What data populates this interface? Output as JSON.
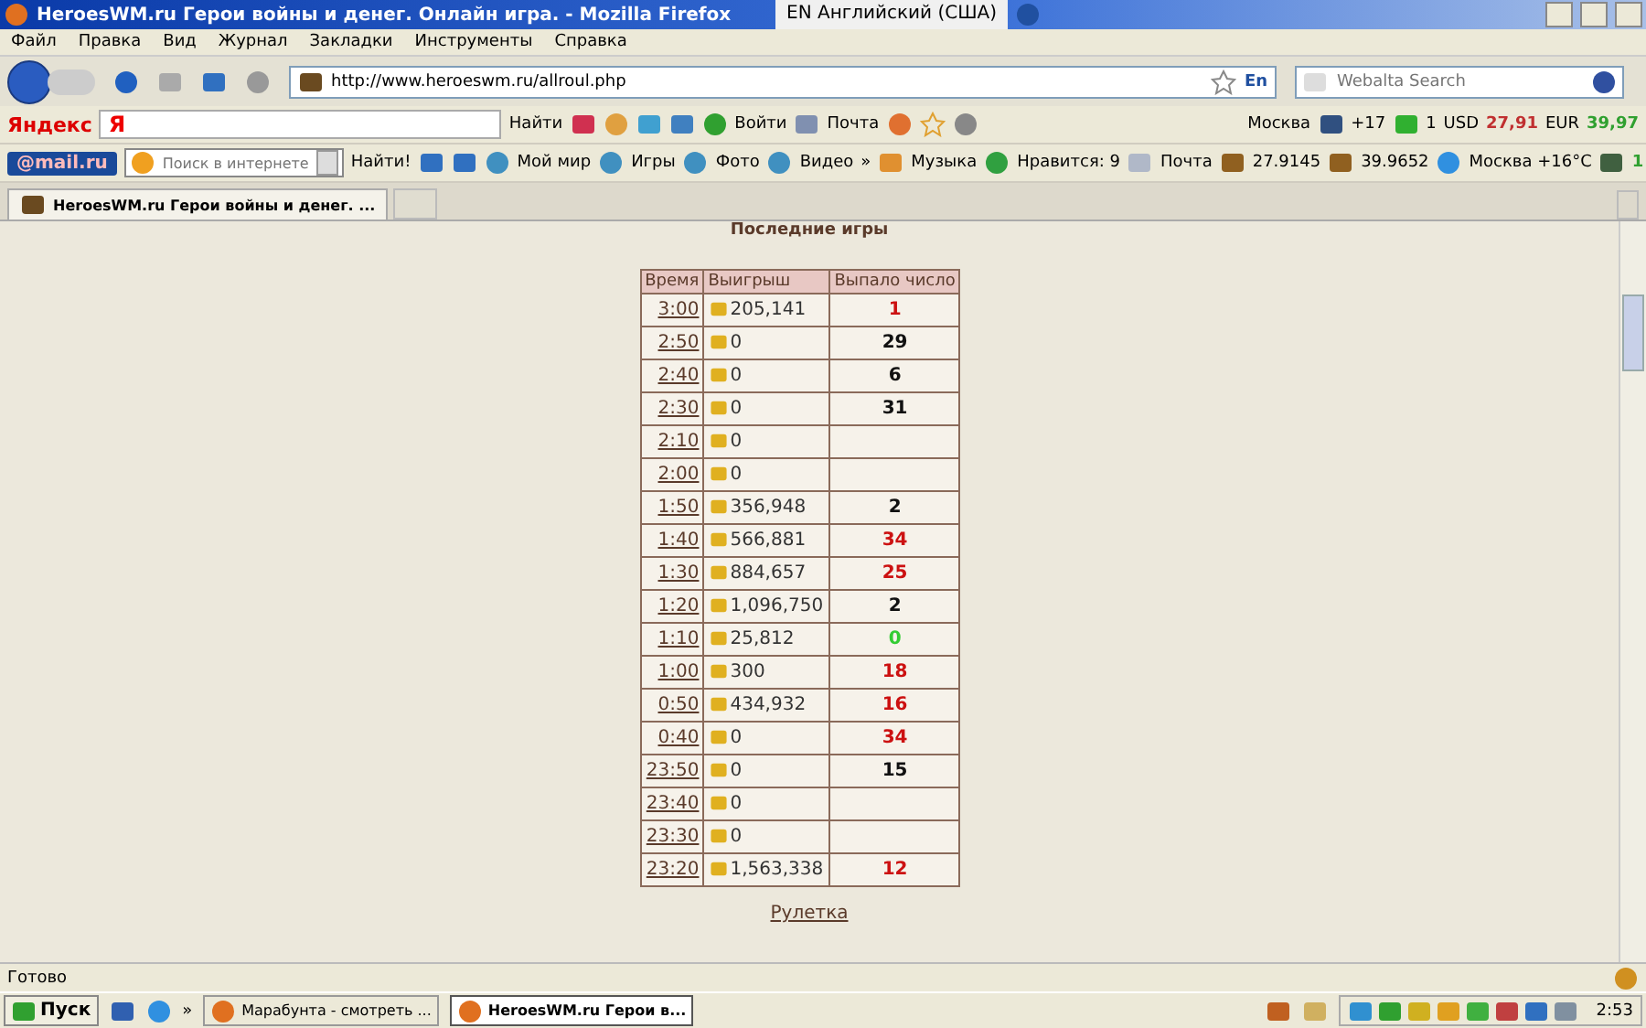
{
  "window": {
    "title": "HeroesWM.ru Герои войны и денег. Онлайн игра. - Mozilla Firefox"
  },
  "language_bar": {
    "text": "EN Английский (США)"
  },
  "menu": [
    "Файл",
    "Правка",
    "Вид",
    "Журнал",
    "Закладки",
    "Инструменты",
    "Справка"
  ],
  "nav": {
    "url": "http://www.heroeswm.ru/allroul.php",
    "lang": "En",
    "search_placeholder": "Webalta Search"
  },
  "yandex_bar": {
    "logo": "Яндекс",
    "field_logo": "Я",
    "find": "Найти",
    "login": "Войти",
    "mail": "Почта",
    "city": "Москва",
    "temp": "+17",
    "count": "1",
    "usd_label": "USD",
    "usd": "27,91",
    "eur_label": "EUR",
    "eur": "39,97"
  },
  "mail_bar": {
    "logo": "@mail.ru",
    "placeholder": "Поиск в интернете",
    "find": "Найти!",
    "links": [
      "Мой мир",
      "Игры",
      "Фото",
      "Видео"
    ],
    "more": "»",
    "music": "Музыка",
    "likes": "Нравится: 9",
    "mail": "Почта",
    "dollar": "27.9145",
    "euro": "39.9652",
    "weather": "Москва +16°C",
    "traffic": "1"
  },
  "tabs": [
    {
      "label": "HeroesWM.ru Герои войны и денег. ...",
      "selected": true
    }
  ],
  "page": {
    "heading": "Последние игры",
    "columns": [
      "Время",
      "Выигрыш",
      "Выпало число"
    ],
    "rows": [
      {
        "time": "3:00",
        "win": "205,141",
        "number": "1",
        "color": "#cc1111"
      },
      {
        "time": "2:50",
        "win": "0",
        "number": "29",
        "color": "#111111"
      },
      {
        "time": "2:40",
        "win": "0",
        "number": "6",
        "color": "#111111"
      },
      {
        "time": "2:30",
        "win": "0",
        "number": "31",
        "color": "#111111"
      },
      {
        "time": "2:10",
        "win": "0"
      },
      {
        "time": "2:00",
        "win": "0"
      },
      {
        "time": "1:50",
        "win": "356,948",
        "number": "2",
        "color": "#111111"
      },
      {
        "time": "1:40",
        "win": "566,881",
        "number": "34",
        "color": "#cc1111"
      },
      {
        "time": "1:30",
        "win": "884,657",
        "number": "25",
        "color": "#cc1111"
      },
      {
        "time": "1:20",
        "win": "1,096,750",
        "number": "2",
        "color": "#111111"
      },
      {
        "time": "1:10",
        "win": "25,812",
        "number": "0",
        "color": "#33cc33"
      },
      {
        "time": "1:00",
        "win": "300",
        "number": "18",
        "color": "#cc1111"
      },
      {
        "time": "0:50",
        "win": "434,932",
        "number": "16",
        "color": "#cc1111"
      },
      {
        "time": "0:40",
        "win": "0",
        "number": "34",
        "color": "#cc1111"
      },
      {
        "time": "23:50",
        "win": "0",
        "number": "15",
        "color": "#111111"
      },
      {
        "time": "23:40",
        "win": "0"
      },
      {
        "time": "23:30",
        "win": "0"
      },
      {
        "time": "23:20",
        "win": "1,563,338",
        "number": "12",
        "color": "#cc1111"
      }
    ],
    "link": "Рулетка"
  },
  "status_bar": {
    "text": "Готово"
  },
  "taskbar": {
    "start": "Пуск",
    "more": "»",
    "tasks": [
      {
        "label": "Марабунта - смотреть ...",
        "selected": false
      },
      {
        "label": "HeroesWM.ru Герои в...",
        "selected": true
      }
    ],
    "clock": "2:53"
  }
}
